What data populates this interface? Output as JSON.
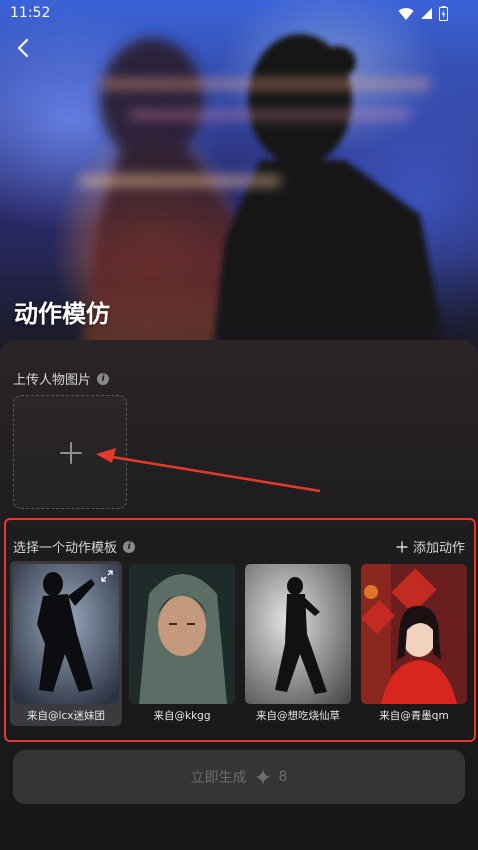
{
  "status_bar": {
    "time": "11:52"
  },
  "header": {
    "title": "动作模仿"
  },
  "upload": {
    "label": "上传人物图片"
  },
  "templates": {
    "label": "选择一个动作模板",
    "add_label": "添加动作",
    "items": [
      {
        "caption": "来自@lcx迷妹团",
        "selected": true
      },
      {
        "caption": "来自@kkgg",
        "selected": false
      },
      {
        "caption": "来自@想吃烧仙草",
        "selected": false
      },
      {
        "caption": "来自@青墨qm",
        "selected": false
      }
    ]
  },
  "generate": {
    "label": "立即生成",
    "cost": "8"
  },
  "colors": {
    "highlight": "#e23b2a",
    "panel": "#1d1c1e",
    "button": "#343537"
  }
}
